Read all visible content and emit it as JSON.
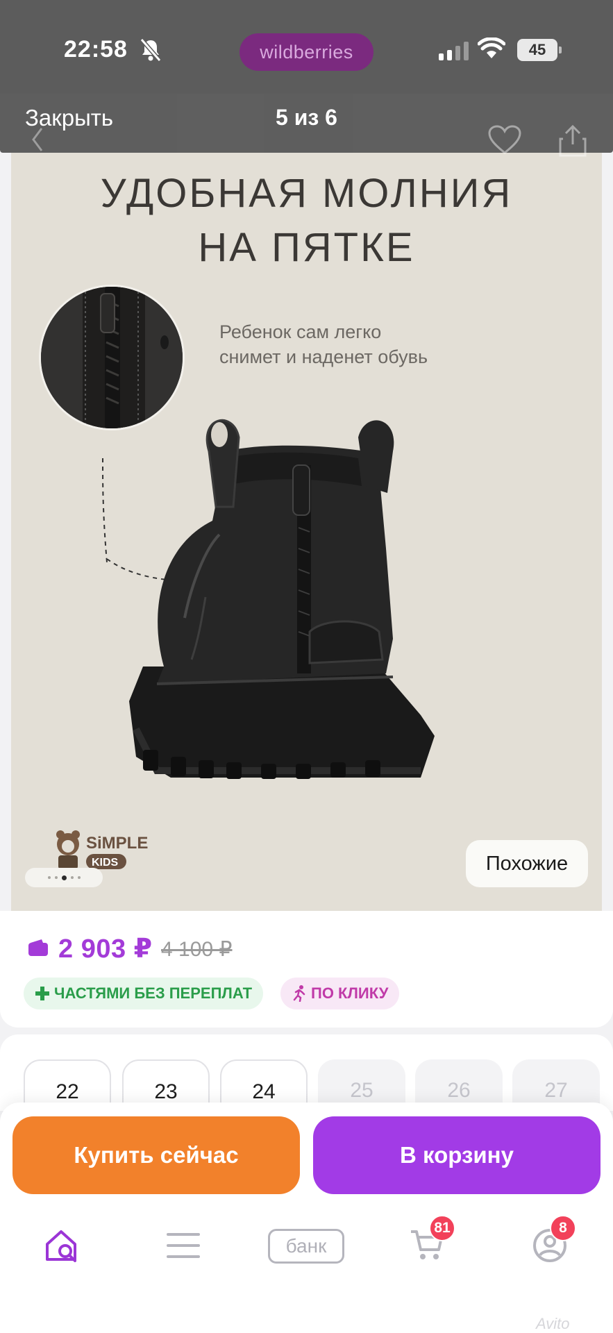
{
  "status_bar": {
    "time": "22:58",
    "brand": "wildberries",
    "battery": "45"
  },
  "viewer": {
    "close_label": "Закрыть",
    "counter": "5 из 6"
  },
  "product_image": {
    "title_line1": "УДОБНАЯ МОЛНИЯ",
    "title_line2": "НА ПЯТКЕ",
    "subtitle_line1": "Ребенок сам легко",
    "subtitle_line2": "снимет и наденет обувь",
    "logo_text": "SiMPLE",
    "logo_badge": "KIDS",
    "similar_label": "Похожие"
  },
  "price": {
    "current": "2 903 ₽",
    "old": "4 100 ₽",
    "badge_installments": "ЧАСТЯМИ БЕЗ ПЕРЕПЛАТ",
    "badge_click": "ПО КЛИКУ"
  },
  "sizes": [
    {
      "label": "22",
      "available": true
    },
    {
      "label": "23",
      "available": true
    },
    {
      "label": "24",
      "available": true
    },
    {
      "label": "25",
      "available": false
    },
    {
      "label": "26",
      "available": false
    },
    {
      "label": "27",
      "available": false
    }
  ],
  "actions": {
    "buy_now": "Купить сейчас",
    "add_to_cart": "В корзину"
  },
  "tab_bar": {
    "bank_label": "банк",
    "cart_count": "81",
    "profile_count": "8"
  },
  "watermark": "Avito",
  "colors": {
    "accent_purple": "#a23be6",
    "accent_orange": "#f2812b",
    "price_purple": "#a33bd8",
    "badge_red": "#f2415a"
  },
  "icons": [
    "bell-muted-icon",
    "signal-icon",
    "wifi-icon",
    "battery-icon",
    "heart-icon",
    "share-icon",
    "back-chevron-icon",
    "wallet-icon",
    "plus-icon",
    "running-icon",
    "home-search-icon",
    "menu-icon",
    "cart-icon",
    "profile-icon"
  ]
}
